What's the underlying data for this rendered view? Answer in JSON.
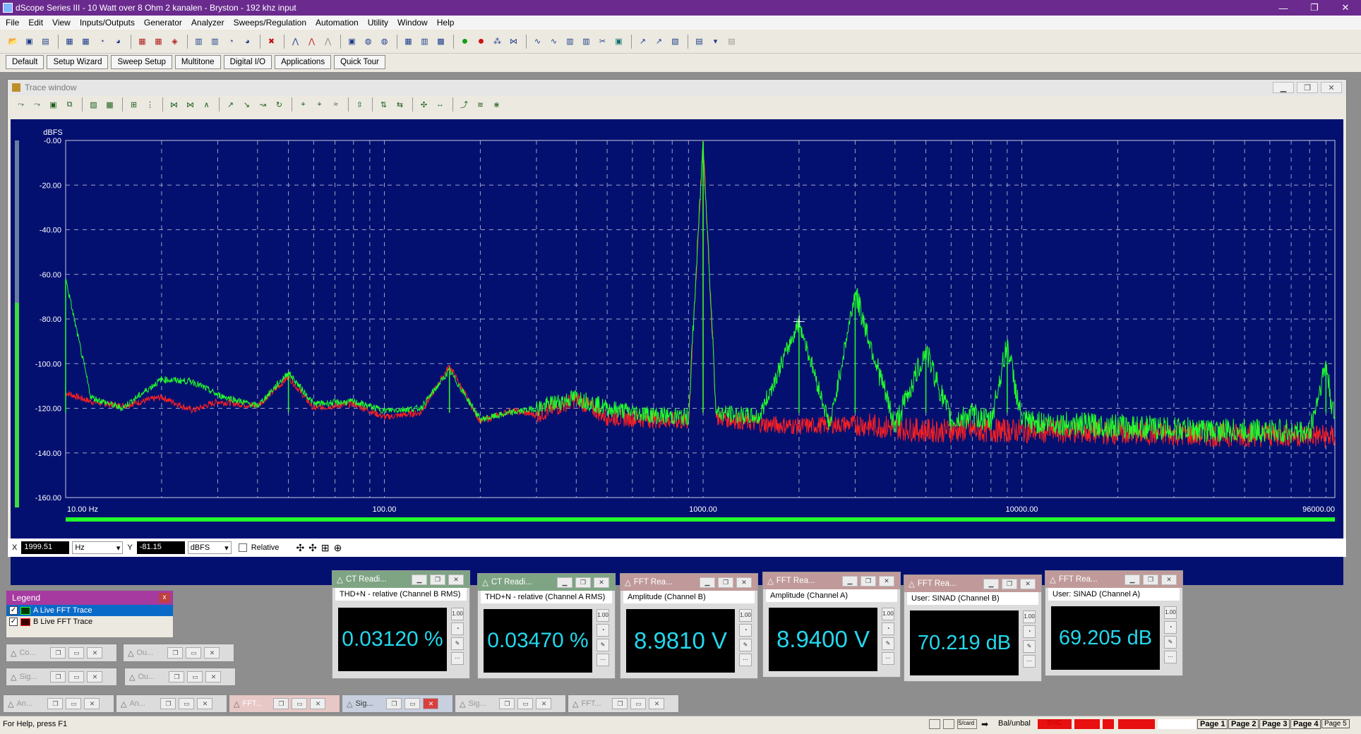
{
  "window": {
    "title": "dScope Series III - 10 Watt over 8 Ohm 2 kanalen - Bryston - 192 khz input",
    "minimize": "—",
    "restore": "❐",
    "close": "✕"
  },
  "menu": [
    "File",
    "Edit",
    "View",
    "Inputs/Outputs",
    "Generator",
    "Analyzer",
    "Sweeps/Regulation",
    "Automation",
    "Utility",
    "Window",
    "Help"
  ],
  "quick_buttons": [
    "Default",
    "Setup Wizard",
    "Sweep Setup",
    "Multitone",
    "Digital I/O",
    "Applications",
    "Quick Tour"
  ],
  "trace_window": {
    "title": "Trace window",
    "cursor": {
      "x_label": "X",
      "x_value": "1999.51",
      "x_unit": "Hz",
      "y_label": "Y",
      "y_value": "-81.15",
      "y_unit": "dBFS",
      "relative_label": "Relative"
    }
  },
  "chart_data": {
    "type": "line",
    "ylabel": "dBFS",
    "y_scale": "linear",
    "x_scale": "log",
    "xlim": [
      10,
      96000
    ],
    "ylim": [
      -160,
      0
    ],
    "y_ticks": [
      "-0.00",
      "-20.00",
      "-40.00",
      "-60.00",
      "-80.00",
      "-100.00",
      "-120.00",
      "-140.00",
      "-160.00"
    ],
    "x_ticks": [
      "10.00 Hz",
      "100.00",
      "1000.00",
      "10000.00",
      "96000.00"
    ],
    "grid": true,
    "background": "#041070",
    "series": [
      {
        "name": "A Live FFT Trace",
        "color": "#22ff2a",
        "x": [
          10,
          12,
          15,
          20,
          25,
          30,
          40,
          50,
          60,
          80,
          100,
          130,
          160,
          200,
          250,
          300,
          400,
          500,
          700,
          900,
          1000,
          1100,
          1500,
          2000,
          2500,
          3000,
          4000,
          5000,
          6000,
          7000,
          8000,
          9000,
          10000,
          20000,
          40000,
          60000,
          80000,
          90000,
          94000,
          96000
        ],
        "y": [
          -62,
          -115,
          -120,
          -107,
          -108,
          -114,
          -119,
          -104,
          -118,
          -117,
          -121,
          -120,
          -103,
          -125,
          -122,
          -120,
          -115,
          -120,
          -123,
          -124,
          -0.3,
          -122,
          -124,
          -81,
          -128,
          -68,
          -128,
          -94,
          -126,
          -123,
          -126,
          -91,
          -126,
          -128,
          -130,
          -130,
          -131,
          -100,
          -120,
          -125
        ]
      },
      {
        "name": "B Live FFT Trace",
        "color": "#ff2020",
        "x": [
          10,
          12,
          15,
          20,
          25,
          30,
          40,
          50,
          60,
          80,
          100,
          130,
          160,
          200,
          250,
          300,
          400,
          500,
          700,
          900,
          1000,
          1100,
          1500,
          2000,
          3000,
          5000,
          10000,
          20000,
          40000,
          80000,
          96000
        ],
        "y": [
          -113,
          -117,
          -119,
          -115,
          -121,
          -117,
          -119,
          -106,
          -120,
          -118,
          -124,
          -122,
          -101,
          -126,
          -121,
          -123,
          -116,
          -124,
          -125,
          -126,
          -0.5,
          -124,
          -127,
          -128,
          -127,
          -130,
          -130,
          -131,
          -132,
          -132,
          -133
        ]
      }
    ]
  },
  "legend": {
    "title": "Legend",
    "close": "x",
    "items": [
      {
        "label": "A  Live FFT Trace",
        "checked": "✓",
        "color": "#22ff2a"
      },
      {
        "label": "B  Live FFT Trace",
        "checked": "✓",
        "color": "#ff2020"
      }
    ]
  },
  "readings": [
    {
      "title": "CT Readi...",
      "subtitle": "THD+N - relative (Channel B RMS)",
      "value": "0.03120 %",
      "title_color": "#5d8a5e"
    },
    {
      "title": "CT Readi...",
      "subtitle": "THD+N - relative (Channel A RMS)",
      "value": "0.03470 %",
      "title_color": "#5d8a5e"
    },
    {
      "title": "FFT Rea...",
      "subtitle": "Amplitude (Channel B)",
      "value": "8.9810 V",
      "title_color": "#b07070"
    },
    {
      "title": "FFT Rea...",
      "subtitle": "Amplitude (Channel A)",
      "value": "8.9400 V",
      "title_color": "#b07070"
    },
    {
      "title": "FFT Rea...",
      "subtitle": "User: SINAD (Channel B)",
      "value": "70.219 dB",
      "title_color": "#b07070"
    },
    {
      "title": "FFT Rea...",
      "subtitle": "User: SINAD (Channel A)",
      "value": "69.205 dB",
      "title_color": "#b07070"
    }
  ],
  "minimized_windows": {
    "row1": [
      "Co...",
      "Ou..."
    ],
    "row2": [
      "Sig...",
      "Ou..."
    ],
    "row3": [
      "An...",
      "An...",
      "FFT...",
      "Sig...",
      "Sig...",
      "FFT..."
    ]
  },
  "status": {
    "help": "For Help, press F1",
    "bal": "Bal/unbal",
    "bnc": "BNC",
    "pages": [
      "Page 1",
      "Page 2",
      "Page 3",
      "Page 4",
      "Page 5"
    ]
  }
}
